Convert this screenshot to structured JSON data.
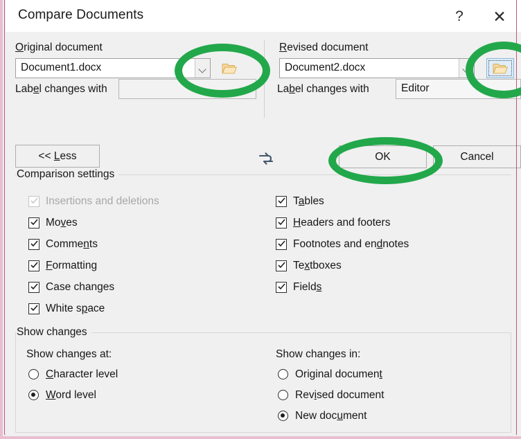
{
  "window": {
    "title": "Compare Documents",
    "help_label": "?",
    "close_label": "✕"
  },
  "colors": {
    "frame_pink": "#e9bfd0",
    "frame_pink_line": "#b8577e",
    "dialog_bg": "#f0f0f0",
    "titlebar_bg": "#ffffff",
    "highlight_green": "#22a84a",
    "swap_icon": "#41556b",
    "folder_icon": "#e8b96a"
  },
  "original": {
    "label": "Original document",
    "label_pre": "O",
    "label_post": "riginal document",
    "document_value": "Document1.docx",
    "dropdown_icon": "chevron-down-icon",
    "browse_icon": "folder-open-icon",
    "label_changes_pre": "Lab",
    "label_changes_key": "e",
    "label_changes_post": "l changes with",
    "label_changes_value": ""
  },
  "revised": {
    "label_pre": "R",
    "label_post": "evised document",
    "document_value": "Document2.docx",
    "dropdown_icon": "chevron-down-icon",
    "browse_icon": "folder-open-icon",
    "label_changes_pre": "La",
    "label_changes_key": "b",
    "label_changes_post": "el changes with",
    "label_changes_value": "Editor"
  },
  "swap": {
    "icon": "swap-arrows-icon"
  },
  "buttons": {
    "less_pre": "<< ",
    "less_key": "L",
    "less_post": "ess",
    "ok": "OK",
    "cancel": "Cancel"
  },
  "comparison_settings": {
    "group_label": "Comparison settings",
    "left_column": [
      {
        "pre": "",
        "key": "",
        "post": "Insertions and deletions",
        "checked": true,
        "disabled": true
      },
      {
        "pre": "Mo",
        "key": "v",
        "post": "es",
        "checked": true,
        "disabled": false
      },
      {
        "pre": "Comme",
        "key": "n",
        "post": "ts",
        "checked": true,
        "disabled": false
      },
      {
        "pre": "",
        "key": "F",
        "post": "ormatting",
        "checked": true,
        "disabled": false
      },
      {
        "pre": "Case chan",
        "key": "g",
        "post": "es",
        "checked": true,
        "disabled": false
      },
      {
        "pre": "White s",
        "key": "p",
        "post": "ace",
        "checked": true,
        "disabled": false
      }
    ],
    "right_column": [
      {
        "pre": "T",
        "key": "a",
        "post": "bles",
        "checked": true,
        "disabled": false
      },
      {
        "pre": "",
        "key": "H",
        "post": "eaders and footers",
        "checked": true,
        "disabled": false
      },
      {
        "pre": "Footnotes and en",
        "key": "d",
        "post": "notes",
        "checked": true,
        "disabled": false
      },
      {
        "pre": "Te",
        "key": "x",
        "post": "tboxes",
        "checked": true,
        "disabled": false
      },
      {
        "pre": "Field",
        "key": "s",
        "post": "",
        "checked": true,
        "disabled": false
      }
    ]
  },
  "show_changes": {
    "group_label": "Show changes",
    "at_label": "Show changes at:",
    "at_options": [
      {
        "pre": "",
        "key": "C",
        "post": "haracter level",
        "selected": false
      },
      {
        "pre": "",
        "key": "W",
        "post": "ord level",
        "selected": true
      }
    ],
    "in_label": "Show changes in:",
    "in_options": [
      {
        "pre": "Original documen",
        "key": "t",
        "post": "",
        "selected": false
      },
      {
        "pre": "Rev",
        "key": "i",
        "post": "sed document",
        "selected": false
      },
      {
        "pre": "New doc",
        "key": "u",
        "post": "ment",
        "selected": true
      }
    ]
  },
  "annotations": {
    "highlight_original_browse": "green-ellipse-highlight",
    "highlight_revised_browse": "green-ellipse-highlight",
    "highlight_ok": "green-ellipse-highlight"
  }
}
